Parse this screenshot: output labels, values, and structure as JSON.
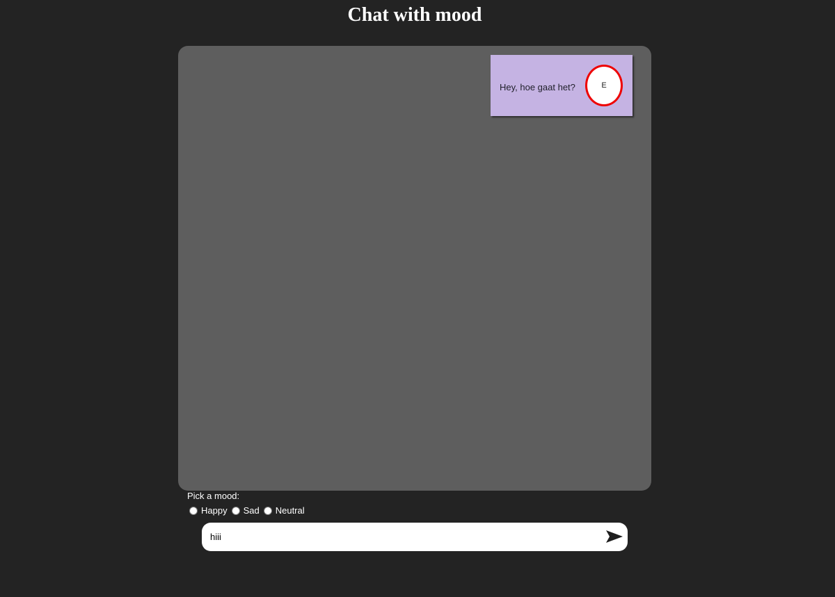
{
  "page": {
    "title": "Chat with mood"
  },
  "chat": {
    "messages": [
      {
        "text": "Hey, hoe gaat het?",
        "avatar_initial": "E",
        "bubble_color": "#c5b3e3",
        "avatar_ring_color": "#ee0000"
      }
    ]
  },
  "mood": {
    "label": "Pick a mood:",
    "options": [
      {
        "label": "Happy",
        "value": "happy",
        "checked": false
      },
      {
        "label": "Sad",
        "value": "sad",
        "checked": false
      },
      {
        "label": "Neutral",
        "value": "neutral",
        "checked": false
      }
    ]
  },
  "composer": {
    "value": "hiii",
    "send_icon": "send-arrow-icon"
  },
  "colors": {
    "background": "#232323",
    "chat_panel": "#5e5e5e"
  }
}
